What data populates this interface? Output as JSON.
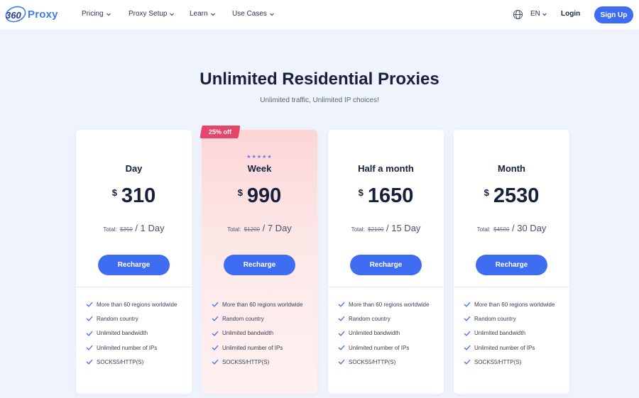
{
  "header": {
    "logo_text": "Proxy",
    "logo_mark": "360",
    "nav": [
      {
        "label": "Pricing"
      },
      {
        "label": "Proxy Setup"
      },
      {
        "label": "Learn"
      },
      {
        "label": "Use Cases"
      }
    ],
    "language": "EN",
    "login_label": "Login",
    "signup_label": "Sign Up"
  },
  "hero": {
    "title": "Unlimited Residential Proxies",
    "subtitle": "Unlimited traffic, Unlimited IP choices!"
  },
  "plans": [
    {
      "name": "Day",
      "currency": "$",
      "price": "310",
      "total_label": "Total:",
      "original_price": "$350",
      "duration": "1 Day",
      "button_label": "Recharge",
      "badge": "",
      "stars": "",
      "features": [
        "More than 60 regions worldwide",
        "Random country",
        "Unlimited bandwidth",
        "Unlimited number of IPs",
        "SOCKS5/HTTP(S)"
      ]
    },
    {
      "name": "Week",
      "currency": "$",
      "price": "990",
      "total_label": "Total:",
      "original_price": "$1200",
      "duration": "7 Day",
      "button_label": "Recharge",
      "badge": "25% off",
      "stars": "★★★★★",
      "features": [
        "More than 60 regions worldwide",
        "Random country",
        "Unlimited bandwidth",
        "Unlimited number of IPs",
        "SOCKS5/HTTP(S)"
      ]
    },
    {
      "name": "Half a month",
      "currency": "$",
      "price": "1650",
      "total_label": "Total:",
      "original_price": "$2100",
      "duration": "15 Day",
      "button_label": "Recharge",
      "badge": "",
      "stars": "",
      "features": [
        "More than 60 regions worldwide",
        "Random country",
        "Unlimited bandwidth",
        "Unlimited number of IPs",
        "SOCKS5/HTTP(S)"
      ]
    },
    {
      "name": "Month",
      "currency": "$",
      "price": "2530",
      "total_label": "Total:",
      "original_price": "$4500",
      "duration": "30 Day",
      "button_label": "Recharge",
      "badge": "",
      "stars": "",
      "features": [
        "More than 60 regions worldwide",
        "Random country",
        "Unlimited bandwidth",
        "Unlimited number of IPs",
        "SOCKS5/HTTP(S)"
      ]
    }
  ],
  "colors": {
    "primary": "#3f6df2",
    "badge": "#e8456a",
    "stars": "#7a6cf2",
    "background": "#eef3fc",
    "featured_card": "#fdd6d6"
  },
  "icons": {
    "logo": "360-proxy-logo",
    "nav_dropdown": "chevron-down-icon",
    "language": "globe-icon",
    "feature": "check-icon"
  }
}
